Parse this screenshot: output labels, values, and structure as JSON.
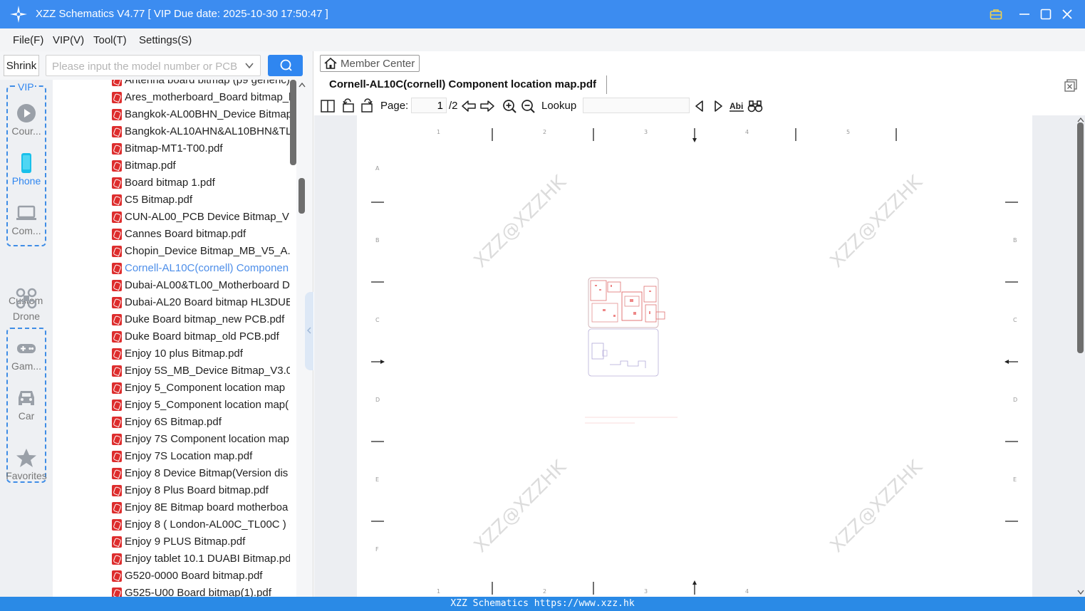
{
  "window": {
    "title": "XZZ Schematics V4.77 [ VIP Due date: 2025-10-30 17:50:47 ]"
  },
  "menu": {
    "items": [
      "File(F)",
      "VIP(V)",
      "Tool(T)",
      "Settings(S)"
    ]
  },
  "left_panel": {
    "shrink_label": "Shrink",
    "search_placeholder": "Please input the model number or PCB",
    "vip_group_title": "VIP",
    "custom_group_title": "Custom",
    "categories": [
      {
        "label": "Cour...",
        "icon": "play-icon"
      },
      {
        "label": "Phone",
        "icon": "phone-icon",
        "active": true
      },
      {
        "label": "Com...",
        "icon": "laptop-icon"
      },
      {
        "label": "Drone",
        "icon": "drone-icon"
      },
      {
        "label": "Gam...",
        "icon": "gamepad-icon"
      },
      {
        "label": "Car",
        "icon": "car-icon"
      },
      {
        "label": "Favorites",
        "icon": "star-icon"
      }
    ],
    "files": [
      "Antenna board bitmap (p9 generic)",
      "Ares_motherboard_Board bitmap_l",
      "Bangkok-AL00BHN_Device Bitmap",
      "Bangkok-AL10AHN&AL10BHN&TL",
      "Bitmap-MT1-T00.pdf",
      "Bitmap.pdf",
      "Board bitmap 1.pdf",
      "C5 Bitmap.pdf",
      "CUN-AL00_PCB Device Bitmap_V1.0",
      "Cannes Board bitmap.pdf",
      "Chopin_Device Bitmap_MB_V5_A.p",
      "Cornell-AL10C(cornell) Componen",
      "Dubai-AL00&TL00_Motherboard D",
      "Dubai-AL20 Board bitmap HL3DUE",
      "Duke Board bitmap_new PCB.pdf",
      "Duke Board bitmap_old PCB.pdf",
      "Enjoy 10 plus Bitmap.pdf",
      "Enjoy 5S_MB_Device Bitmap_V3.01",
      "Enjoy 5_Component location map",
      "Enjoy 5_Component location map(",
      "Enjoy 6S Bitmap.pdf",
      "Enjoy 7S Component location map",
      "Enjoy 7S Location map.pdf",
      "Enjoy 8 Device Bitmap(Version dis",
      "Enjoy 8 Plus Board bitmap.pdf",
      "Enjoy 8E Bitmap board motherboa",
      "Enjoy 8 ( London-AL00C_TL00C ) (4",
      "Enjoy 9 PLUS Bitmap.pdf",
      "Enjoy tablet 10.1 DUABI Bitmap.pd",
      "G520-0000 Board bitmap.pdf",
      "G525-U00 Board bitmap(1).pdf"
    ],
    "selected_index": 11
  },
  "right_panel": {
    "member_center_label": "Member Center",
    "tab_title": "Cornell-AL10C(cornell) Component location map.pdf",
    "toolbar": {
      "page_label": "Page:",
      "current_page": "1",
      "total_pages": "/2",
      "lookup_label": "Lookup",
      "lookup_value": ""
    },
    "document": {
      "column_labels": [
        "1",
        "2",
        "3",
        "4",
        "5"
      ],
      "bottom_column_labels": [
        "1",
        "2",
        "3",
        "4"
      ],
      "row_labels": [
        "A",
        "B",
        "C",
        "D",
        "E",
        "F"
      ],
      "watermark": "XZZ@XZZHK"
    }
  },
  "status_bar": {
    "text": "XZZ Schematics https://www.xzz.hk"
  },
  "colors": {
    "titlebar": "#3c8cf0",
    "accent": "#2f86f0",
    "selected_text": "#4d8ee9",
    "pdf_icon": "#dd2d2d",
    "status_bar": "#2a8ae6"
  }
}
